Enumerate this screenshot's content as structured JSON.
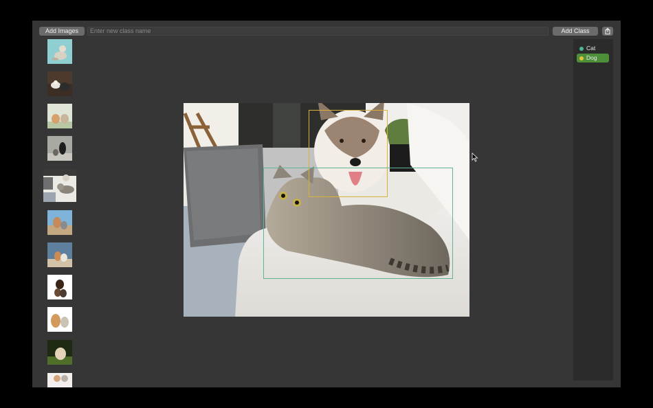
{
  "toolbar": {
    "add_images_label": "Add Images",
    "new_class_placeholder": "Enter new class name",
    "add_class_label": "Add Class",
    "share_icon": "share-icon"
  },
  "thumbnails": [
    {
      "name": "thumb-dog-bowl"
    },
    {
      "name": "thumb-dogs-sofa"
    },
    {
      "name": "thumb-cat-dog-grass"
    },
    {
      "name": "thumb-dog-sitting"
    },
    {
      "name": "thumb-cat-dog-sofa",
      "selected": true
    },
    {
      "name": "thumb-dog-cat-beach"
    },
    {
      "name": "thumb-dog-cat-sky"
    },
    {
      "name": "thumb-dog-cat-white"
    },
    {
      "name": "thumb-dog-cat-white-2"
    },
    {
      "name": "thumb-dog-grass"
    },
    {
      "name": "thumb-partial"
    }
  ],
  "classes": [
    {
      "label": "Cat",
      "color": "#4fb59a",
      "selected": false
    },
    {
      "label": "Dog",
      "color": "#e3c13c",
      "selected": true,
      "highlight": "#4e8f3a"
    }
  ],
  "annotations": [
    {
      "label": "Dog",
      "color": "#d7b13a"
    },
    {
      "label": "Cat",
      "color": "#5fb497"
    }
  ]
}
